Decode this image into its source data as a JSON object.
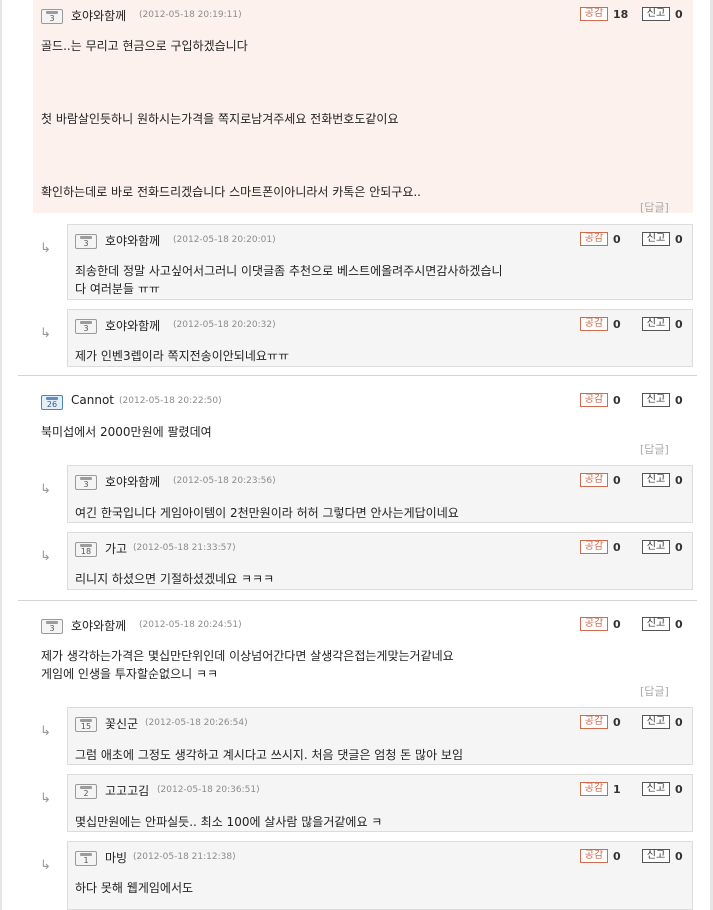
{
  "vote_label": "공감",
  "report_label": "신고",
  "reply_link_label": "[답글]",
  "reply_arrow": "↳",
  "comments": [
    {
      "level": "3",
      "nick": "호야와함께",
      "date": "(2012-05-18 20:19:11)",
      "votes": "18",
      "reports": "0",
      "lines": [
        "골드..는 무리고 현금으로 구입하겠습니다",
        "",
        "",
        "첫 바람살인듯하니 원하시는가격을 쪽지로남겨주세요 전화번호도같이요",
        "",
        "",
        "확인하는데로 바로 전화드리겠습니다 스마트폰이아니라서 카톡은 안되구요.."
      ]
    },
    {
      "level": "3",
      "nick": "호야와함께",
      "date": "(2012-05-18 20:20:01)",
      "votes": "0",
      "reports": "0",
      "lines": [
        "죄송한데 정말 사고싶어서그러니 이댓글좀 추천으로 베스트에올려주시면감사하겠습니",
        "다 여러분들 ㅠㅠ"
      ]
    },
    {
      "level": "3",
      "nick": "호야와함께",
      "date": "(2012-05-18 20:20:32)",
      "votes": "0",
      "reports": "0",
      "lines": [
        "제가 인벤3렙이라 쪽지전송이안되네요ㅠㅠ"
      ]
    },
    {
      "level": "26",
      "nick": "Cannot",
      "date": "(2012-05-18 20:22:50)",
      "votes": "0",
      "reports": "0",
      "lines": [
        "북미섭에서 2000만원에 팔렸데여"
      ]
    },
    {
      "level": "3",
      "nick": "호야와함께",
      "date": "(2012-05-18 20:23:56)",
      "votes": "0",
      "reports": "0",
      "lines": [
        "여긴 한국입니다 게임아이템이 2천만원이라 허허 그렇다면 안사는게답이네요"
      ]
    },
    {
      "level": "18",
      "nick": "가고",
      "date": "(2012-05-18 21:33:57)",
      "votes": "0",
      "reports": "0",
      "lines": [
        "리니지 하셨으면 기절하셨겠네요 ㅋㅋㅋ"
      ]
    },
    {
      "level": "3",
      "nick": "호야와함께",
      "date": "(2012-05-18 20:24:51)",
      "votes": "0",
      "reports": "0",
      "lines": [
        "제가 생각하는가격은 몇십만단위인데 이상넘어간다면 살생각은접는게맞는거같네요",
        "게임에 인생을 투자할순없으니 ㅋㅋ"
      ]
    },
    {
      "level": "15",
      "nick": "꽃신군",
      "date": "(2012-05-18 20:26:54)",
      "votes": "0",
      "reports": "0",
      "lines": [
        "그럼 애초에 그정도 생각하고 계시다고 쓰시지. 처음 댓글은 엄청 돈 많아 보임"
      ]
    },
    {
      "level": "2",
      "nick": "고고고김",
      "date": "(2012-05-18 20:36:51)",
      "votes": "1",
      "reports": "0",
      "lines": [
        "몇십만원에는 안파실듯.. 최소 100에 살사람 많을거같에요 ㅋ"
      ]
    },
    {
      "level": "1",
      "nick": "마빙",
      "date": "(2012-05-18 21:12:38)",
      "votes": "0",
      "reports": "0",
      "lines": [
        "하다 못해 웹게임에서도"
      ]
    }
  ]
}
